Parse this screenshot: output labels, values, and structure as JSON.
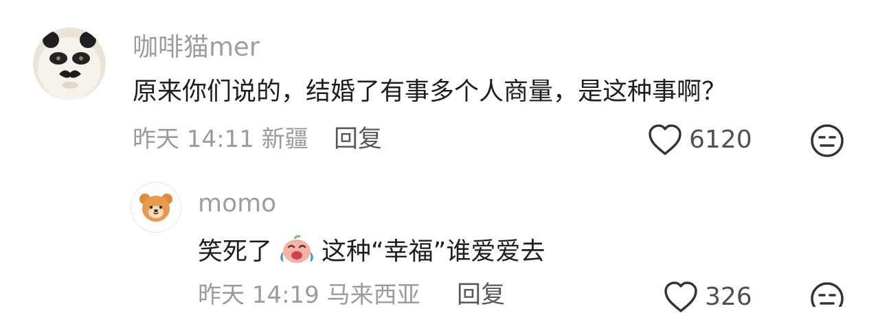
{
  "comments": [
    {
      "username": "咖啡猫mer",
      "text": "原来你们说的，结婚了有事多个人商量，是这种事啊？",
      "time": "昨天 14:11",
      "location": "新疆",
      "reply_label": "回复",
      "likes": "6120"
    }
  ],
  "replies": [
    {
      "username": "momo",
      "text_before": "笑死了",
      "text_after": "这种“幸福”谁爱爱去",
      "time": "昨天 14:19",
      "location": "马来西亚",
      "reply_label": "回复",
      "likes": "326"
    }
  ]
}
